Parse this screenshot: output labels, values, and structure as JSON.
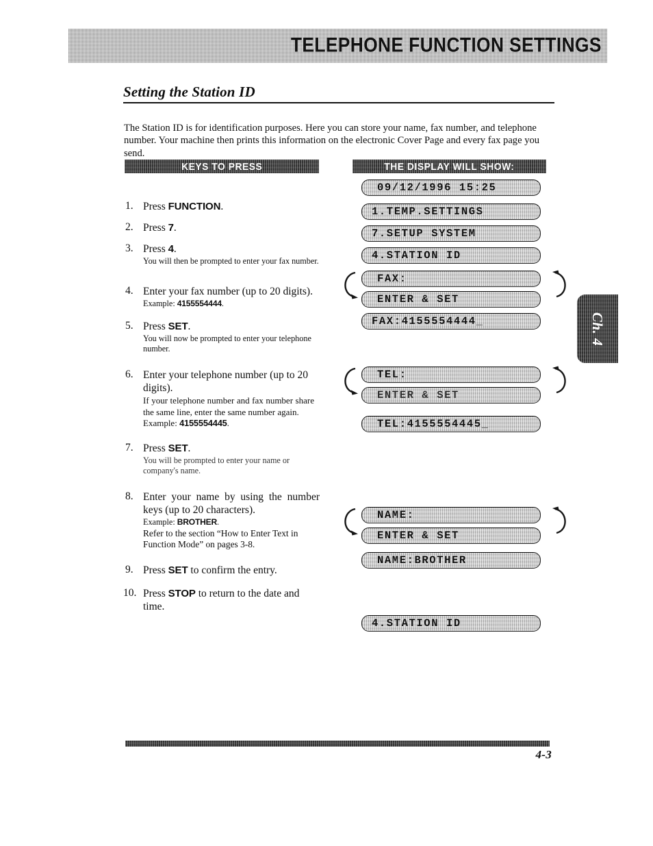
{
  "header": {
    "banner_title": "TELEPHONE FUNCTION SETTINGS"
  },
  "section": {
    "heading": "Setting the Station ID",
    "intro": "The Station ID is for identification purposes. Here you can store your name, fax number, and telephone number. Your machine then prints this information on the electronic Cover Page and every fax page you send."
  },
  "columns": {
    "keys_header": "KEYS TO PRESS",
    "display_header": "THE DISPLAY WILL SHOW:"
  },
  "steps": [
    {
      "num": "1.",
      "main_pre": "Press ",
      "main_key": "FUNCTION",
      "main_post": ".",
      "note": ""
    },
    {
      "num": "2.",
      "main_pre": "Press ",
      "main_key": "7",
      "main_post": ".",
      "note": ""
    },
    {
      "num": "3.",
      "main_pre": "Press ",
      "main_key": "4",
      "main_post": ".",
      "note": "You will then be prompted to enter your fax number."
    },
    {
      "num": "4.",
      "main_pre": "Enter your fax number (up to 20 digits).",
      "main_key": "",
      "main_post": "",
      "example_label": "Example: ",
      "example_value": "4155554444",
      "example_post": "."
    },
    {
      "num": "5.",
      "main_pre": "Press ",
      "main_key": "SET",
      "main_post": ".",
      "note": "You will now be prompted to enter your telephone number."
    },
    {
      "num": "6.",
      "main_pre": "Enter your telephone number (up to 20 digits).",
      "main_key": "",
      "main_post": "",
      "note": "If your telephone  number and fax number share the same line, enter the same number again.",
      "example_label": "Example: ",
      "example_value": "4155554445",
      "example_post": "."
    },
    {
      "num": "7.",
      "main_pre": "Press ",
      "main_key": "SET",
      "main_post": ".",
      "note": "You will be prompted to enter your name or company's name."
    },
    {
      "num": "8.",
      "main_pre": "Enter your name by using the number keys (up to 20 characters).",
      "main_key": "",
      "main_post": "",
      "example_label": "Example: ",
      "example_value": "BROTHER",
      "example_post": ".",
      "note2": "Refer to the section “How to Enter Text in Function Mode” on pages 3-8."
    },
    {
      "num": "9.",
      "main_pre": "Press ",
      "main_key": "SET",
      "main_post": " to confirm the entry.",
      "note": ""
    },
    {
      "num": "10.",
      "main_pre": "Press ",
      "main_key": "STOP",
      "main_post": " to return to the date and time.",
      "note": ""
    }
  ],
  "displays": {
    "datetime": "09/12/1996 15:25",
    "menu_temp": "1.TEMP.SETTINGS",
    "menu_setup": "7.SETUP SYSTEM",
    "menu_station": "4.STATION ID",
    "fax_prompt": "FAX:",
    "fax_enter_set": "ENTER & SET",
    "fax_value": "FAX:4155554444_",
    "tel_prompt": "TEL:",
    "tel_enter_set": "ENTER & SET",
    "tel_value": "TEL:4155554445_",
    "name_prompt": "NAME:",
    "name_enter_set": "ENTER & SET",
    "name_value": "NAME:BROTHER",
    "menu_station_end": "4.STATION ID"
  },
  "chapter_tab": "Ch. 4",
  "footer": {
    "page_number": "4-3"
  }
}
